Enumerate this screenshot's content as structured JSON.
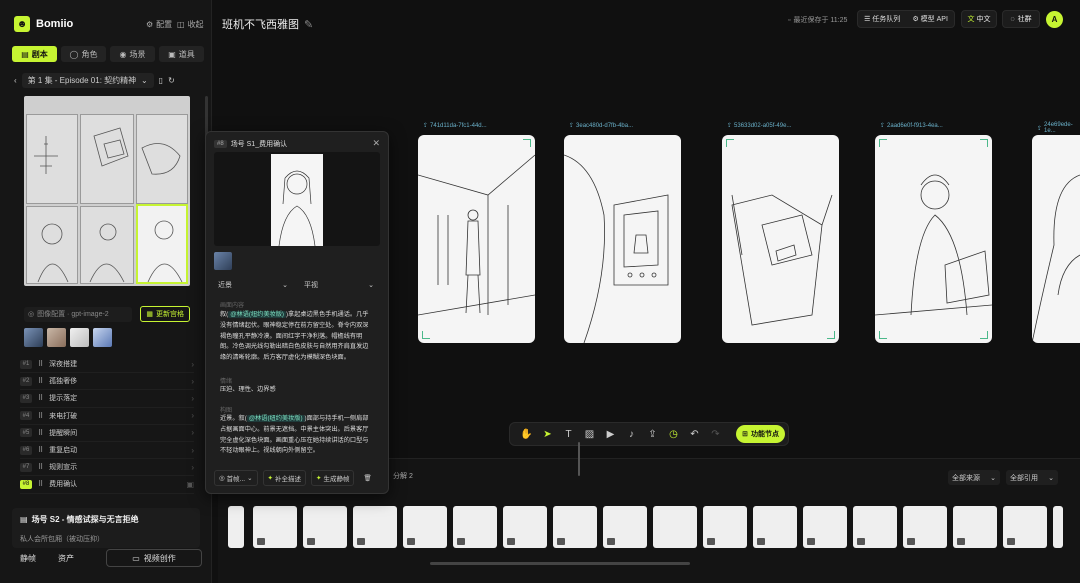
{
  "app": {
    "brand": "Bomiio",
    "config": "配置",
    "collect": "收起"
  },
  "nav": [
    "剧本",
    "角色",
    "场景",
    "道具"
  ],
  "episode": {
    "label": "第 1 集 - Episode 01: 契约精神"
  },
  "model": {
    "label": "图像配置 · gpt-image-2",
    "update": "更新宫格"
  },
  "shots": [
    {
      "num": "#1",
      "label": "深夜搭建"
    },
    {
      "num": "#2",
      "label": "孤独奢侈"
    },
    {
      "num": "#3",
      "label": "提示落定"
    },
    {
      "num": "#4",
      "label": "来电打破"
    },
    {
      "num": "#5",
      "label": "提醒瞬间"
    },
    {
      "num": "#6",
      "label": "重复启动"
    },
    {
      "num": "#7",
      "label": "规则宣示"
    },
    {
      "num": "#8",
      "label": "费用确认"
    }
  ],
  "scene2": {
    "title": "场号 S2 - 情感试探与无言拒绝",
    "sub": "私人会所包厢（被动压抑）"
  },
  "bottom": {
    "static": "静帧",
    "assets": "资产",
    "video": "视频创作"
  },
  "project": {
    "title": "班机不飞西雅图"
  },
  "saved": "最近保存于 11:25",
  "top": {
    "tasks": "任务队列",
    "api": "模型 API",
    "lang": "中文",
    "community": "社群",
    "avatar": "A"
  },
  "frames": [
    {
      "id": "741d11da-7fc1-44d..."
    },
    {
      "id": "3eac480d-d7fb-4ba..."
    },
    {
      "id": "53633d02-a05f-49e..."
    },
    {
      "id": "2aad6e0f-f913-4ea..."
    },
    {
      "id": "24e69ede-1e..."
    }
  ],
  "toolbar": {
    "function": "功能节点"
  },
  "strip": {
    "group": "分解 2",
    "source": "全部来源",
    "ref": "全部引用"
  },
  "popup": {
    "tag": "#8",
    "title": "场号 S1_费用确认",
    "shot": "近景",
    "angle": "平视",
    "sec_visual": "画面内容",
    "text1a": "叙(",
    "chip1": "@林语(纽约美妆版)",
    "text1b": ")拿起桌边黑色手机通话。几乎没有情绪起伏。眼神稳定停在前方留空处。脊令内双深褐色瞳孔平静冷漠。面间红字干净利落。帽檐线有明朗。冷色调光线勾勒出暗白色皮肤与自然用齐肩直发边缘的清晰轮廓。后方客厅虚化为模糊深色块面。",
    "sec_mood": "情绪",
    "mood": "压迫、理性、边界感",
    "sec_cam": "构图",
    "text2a": "近景。叙(",
    "chip2": "@林语(纽约美妆版)",
    "text2b": ")面部与持手机一侧肩部占据画面中心。前景无遮挡。中景主体突出。后景客厅完全虚化深色块面。画面重心压在她持续讲话的口型与不轻动眼神上。视线朝向外侧留空。",
    "f1": "首帧...",
    "f2": "补全描述",
    "f3": "生成静帧"
  }
}
